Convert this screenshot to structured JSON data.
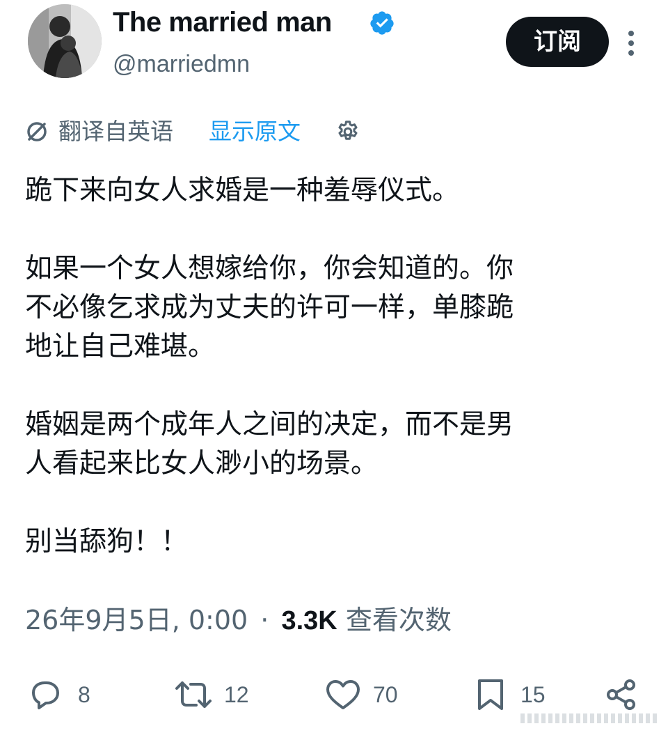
{
  "author": {
    "display_name": "The married man",
    "handle": "@marriedmn",
    "verified": true
  },
  "header": {
    "subscribe_label": "订阅",
    "more_icon": "more-vertical-icon"
  },
  "translation": {
    "label": "翻译自英语",
    "show_original": "显示原文",
    "settings_icon": "gear-icon"
  },
  "tweet": {
    "lines": [
      "跪下来向女人求婚是一种羞辱仪式。",
      "如果一个女人想嫁给你，你会知道的。你",
      "不必像乞求成为丈夫的许可一样，单膝跪",
      "地让自己难堪。",
      "婚姻是两个成年人之间的决定，而不是男",
      "人看起来比女人渺小的场景。",
      "别当舔狗！！"
    ]
  },
  "meta": {
    "timestamp": "26年9月5日, 0:00",
    "separator": "·",
    "views_count": "3.3K",
    "views_label": "查看次数"
  },
  "actions": {
    "replies": "8",
    "reposts": "12",
    "likes": "70",
    "bookmarks": "15"
  },
  "colors": {
    "text": "#0f1419",
    "secondary": "#536471",
    "link": "#1d9bf0",
    "verified": "#1d9bf0",
    "button_bg": "#0f1419"
  }
}
